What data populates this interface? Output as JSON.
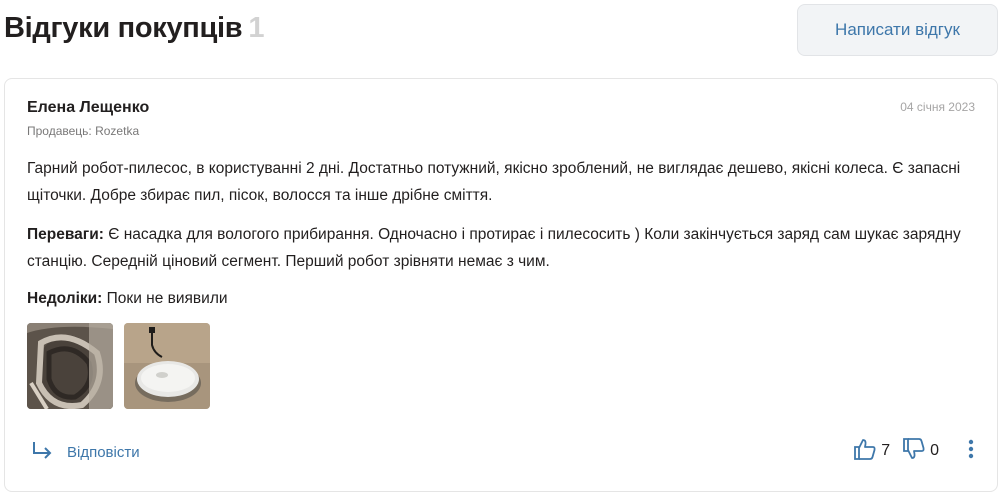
{
  "header": {
    "title": "Відгуки покупців",
    "count": "1",
    "write_button": "Написати відгук"
  },
  "review": {
    "author": "Елена Лещенко",
    "seller": "Продавець: Rozetka",
    "date": "04 січня 2023",
    "text": "Гарний робот-пилесос, в користуванні 2 дні. Достатньо потужний, якісно зроблений, не виглядає дешево, якісні колеса. Є запасні щіточки. Добре збирає пил, пісок, волосся та інше дрібне сміття.",
    "pros_label": "Переваги:",
    "pros": "Є насадка для вологого прибирання. Одночасно і протирає і пилесосить ) Коли закінчується заряд сам шукає зарядну станцію. Середній ціновий сегмент. Перший робот зрівняти немає з чим.",
    "cons_label": "Недоліки:",
    "cons": "Поки не виявили",
    "photos": [
      "robot-brush-photo",
      "robot-vacuum-photo"
    ],
    "reply_label": "Відповісти",
    "likes": "7",
    "dislikes": "0"
  },
  "icons": {
    "reply": "reply-arrow-icon",
    "like": "thumbs-up-icon",
    "dislike": "thumbs-down-icon",
    "more": "more-vertical-icon"
  },
  "colors": {
    "link": "#3e77aa",
    "text": "#221f1f",
    "muted": "#797878",
    "count": "#d2d2d2",
    "button_bg": "#f2f4f6"
  }
}
